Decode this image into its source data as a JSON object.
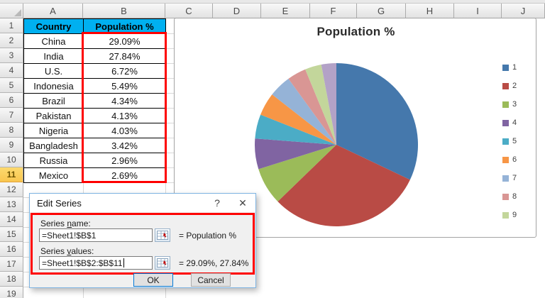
{
  "spreadsheet": {
    "column_letters": [
      "A",
      "B",
      "C",
      "D",
      "E",
      "F",
      "G",
      "H",
      "I",
      "J"
    ],
    "row_numbers": [
      "1",
      "2",
      "3",
      "4",
      "5",
      "6",
      "7",
      "8",
      "9",
      "10",
      "11",
      "12",
      "13",
      "14",
      "15",
      "16",
      "17",
      "18",
      "19"
    ],
    "active_row": "11",
    "table": {
      "headers": [
        "Country",
        "Population %"
      ],
      "rows": [
        [
          "China",
          "29.09%"
        ],
        [
          "India",
          "27.84%"
        ],
        [
          "U.S.",
          "6.72%"
        ],
        [
          "Indonesia",
          "5.49%"
        ],
        [
          "Brazil",
          "4.34%"
        ],
        [
          "Pakistan",
          "4.13%"
        ],
        [
          "Nigeria",
          "4.03%"
        ],
        [
          "Bangladesh",
          "3.42%"
        ],
        [
          "Russia",
          "2.96%"
        ],
        [
          "Mexico",
          "2.69%"
        ]
      ]
    },
    "header_fill_color": "#00b0f0",
    "range_highlight_color": "#fe0000"
  },
  "chart_data": {
    "type": "pie",
    "title": "Population %",
    "categories": [
      "China",
      "India",
      "U.S.",
      "Indonesia",
      "Brazil",
      "Pakistan",
      "Nigeria",
      "Bangladesh",
      "Russia",
      "Mexico"
    ],
    "values": [
      29.09,
      27.84,
      6.72,
      5.49,
      4.34,
      4.13,
      4.03,
      3.42,
      2.96,
      2.69
    ],
    "colors": [
      "#4578ac",
      "#b94b45",
      "#9bbb59",
      "#8064a2",
      "#4bacc6",
      "#f79646",
      "#95b3d7",
      "#d99694",
      "#c3d69b",
      "#b3a2c7"
    ],
    "legend_labels": [
      "1",
      "2",
      "3",
      "4",
      "5",
      "6",
      "7",
      "8",
      "9"
    ],
    "legend_position": "right",
    "start_angle_deg": 0,
    "direction": "clockwise"
  },
  "dialog": {
    "title": "Edit Series",
    "help_icon": "?",
    "close_icon": "✕",
    "series_name": {
      "label_pre": "Series ",
      "label_accel": "n",
      "label_post": "ame:",
      "value": "=Sheet1!$B$1",
      "preview": "= Population %"
    },
    "series_values": {
      "label_pre": "Series ",
      "label_accel": "v",
      "label_post": "alues:",
      "value": "=Sheet1!$B$2:$B$11",
      "preview": "= 29.09%, 27.84%"
    },
    "ok_label": "OK",
    "cancel_label": "Cancel"
  }
}
